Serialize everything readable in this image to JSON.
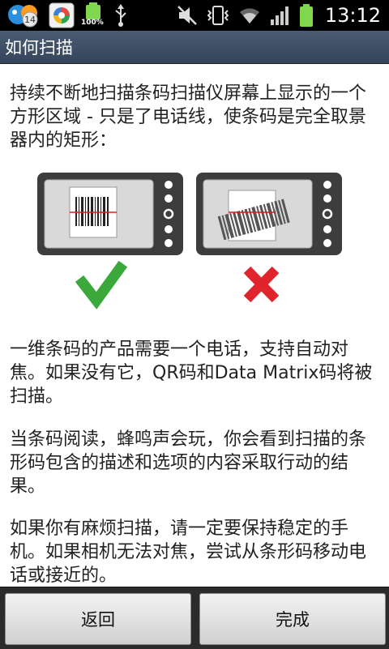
{
  "status_bar": {
    "notification_badge": "14",
    "battery_label": "100%",
    "time": "13:12",
    "icons": [
      "chat-app-icon",
      "store-app-icon",
      "battery-full-notification-icon",
      "usb-icon",
      "muted-icon",
      "vibrate-icon",
      "wifi-icon",
      "signal-icon",
      "battery-icon"
    ]
  },
  "title_bar": {
    "title": "如何扫描"
  },
  "content": {
    "paragraph_1": "持续不断地扫描条码扫描仪屏幕上显示的一个方形区域 - 只是了电话线，使条码是完全取景器内的矩形：",
    "paragraph_2": "一维条码的产品需要一个电话，支持自动对焦。如果没有它，QR码和Data Matrix码将被扫描。",
    "paragraph_3": "当条码阅读，蜂鸣声会玩，你会看到扫描的条形码包含的描述和选项的内容采取行动的结果。",
    "paragraph_4": "如果你有麻烦扫描，请一定要保持稳定的手机。如果相机无法对焦，尝试从条形码移动电话或接近的。"
  },
  "illustration": {
    "correct_mark": "check-icon",
    "wrong_mark": "cross-icon",
    "colors": {
      "correct": "#3aa83a",
      "wrong": "#e0242c",
      "phone_frame": "#3d3d3d",
      "laser": "#d42020"
    }
  },
  "buttons": {
    "back_label": "返回",
    "done_label": "完成"
  },
  "colors": {
    "title_bar": "#3f4f66",
    "bottom_bar": "#2b2b2b"
  }
}
